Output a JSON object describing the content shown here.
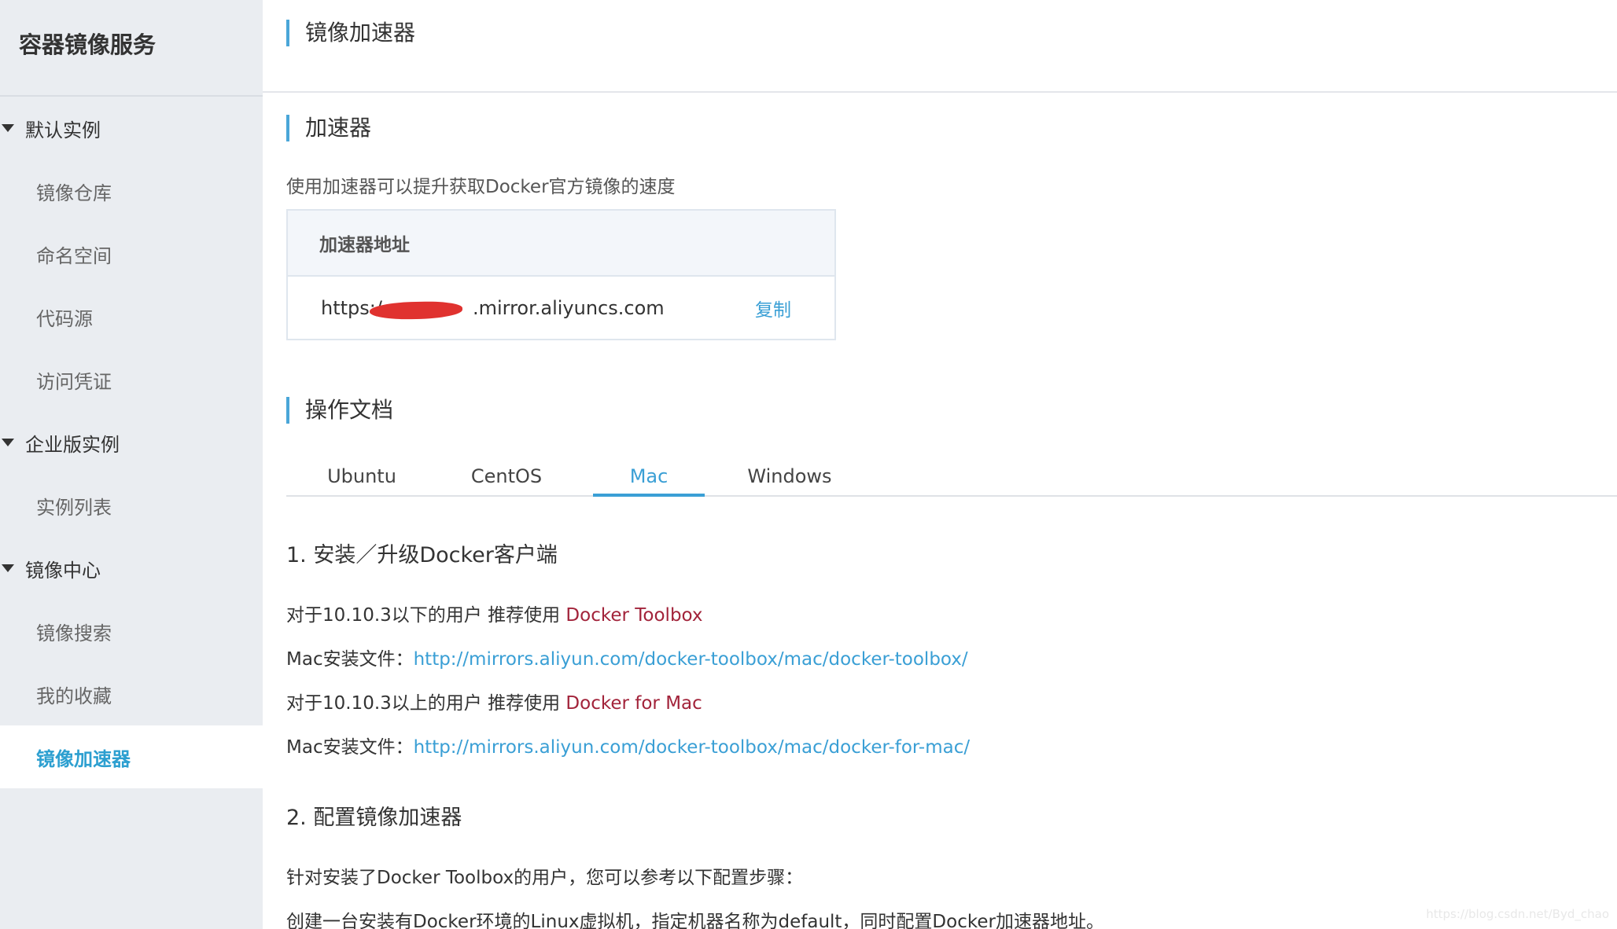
{
  "sidebar": {
    "title": "容器镜像服务",
    "groups": [
      {
        "label": "默认实例",
        "items": [
          "镜像仓库",
          "命名空间",
          "代码源",
          "访问凭证"
        ]
      },
      {
        "label": "企业版实例",
        "items": [
          "实例列表"
        ]
      },
      {
        "label": "镜像中心",
        "items": [
          "镜像搜索",
          "我的收藏",
          "镜像加速器"
        ]
      }
    ],
    "active_item": "镜像加速器"
  },
  "page": {
    "title": "镜像加速器"
  },
  "accelerator": {
    "heading": "加速器",
    "description": "使用加速器可以提升获取Docker官方镜像的速度",
    "box_header": "加速器地址",
    "url_prefix": "https:/",
    "url_suffix": ".mirror.aliyuncs.com",
    "copy_label": "复制"
  },
  "docs": {
    "heading": "操作文档",
    "tabs": [
      "Ubuntu",
      "CentOS",
      "Mac",
      "Windows"
    ],
    "active_tab": "Mac",
    "step1": {
      "title": "1. 安装／升级Docker客户端",
      "line1_text": "对于10.10.3以下的用户 推荐使用 ",
      "line1_link": "Docker Toolbox",
      "line2_label": "Mac安装文件：",
      "line2_link": "http://mirrors.aliyun.com/docker-toolbox/mac/docker-toolbox/",
      "line3_text": "对于10.10.3以上的用户 推荐使用 ",
      "line3_link": "Docker for Mac",
      "line4_label": "Mac安装文件：",
      "line4_link": "http://mirrors.aliyun.com/docker-toolbox/mac/docker-for-mac/"
    },
    "step2": {
      "title": "2. 配置镜像加速器",
      "line1": "针对安装了Docker Toolbox的用户，您可以参考以下配置步骤：",
      "line2": "创建一台安装有Docker环境的Linux虚拟机，指定机器名称为default，同时配置Docker加速器地址。"
    }
  },
  "watermark": "https://blog.csdn.net/Byd_chao",
  "colors": {
    "accent": "#3a9fd5",
    "dark_link": "#a2233a",
    "sidebar_bg": "#eaedf1",
    "redaction": "#e0322f"
  }
}
